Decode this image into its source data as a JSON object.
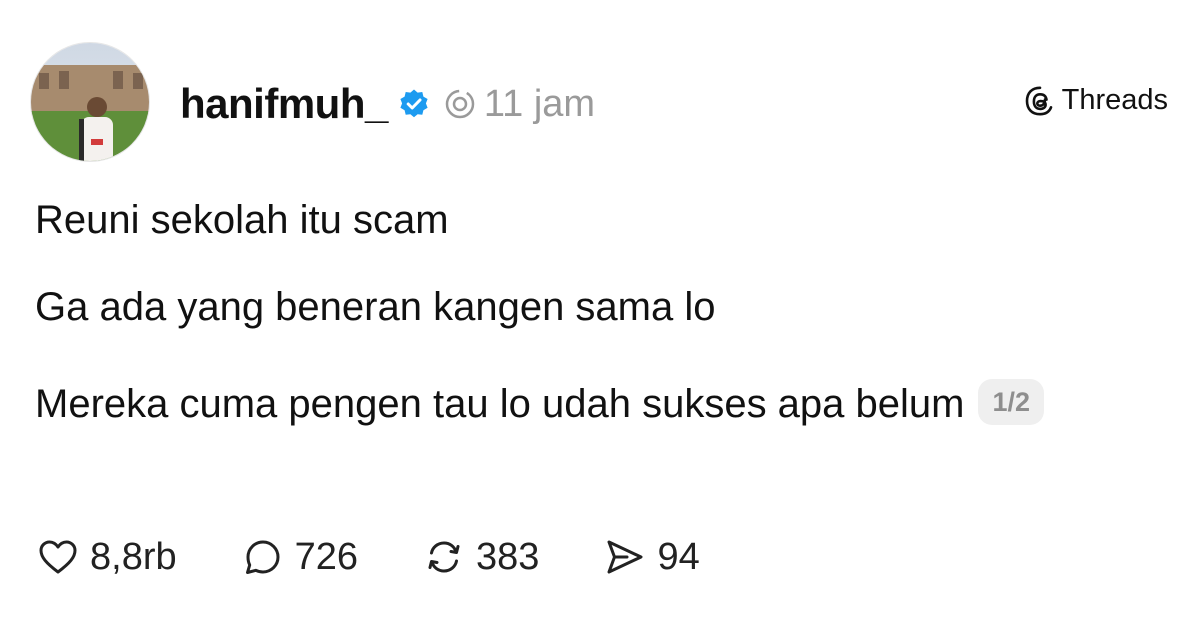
{
  "post": {
    "username": "hanifmuh_",
    "time": "11 jam",
    "brand": "Threads",
    "lines": [
      "Reuni sekolah itu scam",
      "Ga ada yang beneran kangen sama lo",
      "Mereka cuma pengen tau lo udah sukses apa belum"
    ],
    "page_indicator": "1/2",
    "stats": {
      "likes": "8,8rb",
      "replies": "726",
      "reposts": "383",
      "shares": "94"
    }
  },
  "icons": {
    "verified": "verified-badge-icon",
    "time": "threads-time-icon",
    "brand": "threads-logo-icon",
    "like": "heart-icon",
    "reply": "comment-icon",
    "repost": "repost-icon",
    "share": "send-icon"
  },
  "colors": {
    "verified_blue": "#1D9BF0",
    "muted_text": "#9A9A9A"
  }
}
